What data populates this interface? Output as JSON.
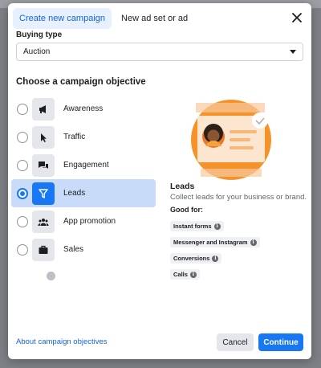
{
  "tabs": [
    {
      "label": "Create new campaign",
      "active": true
    },
    {
      "label": "New ad set or ad",
      "active": false
    }
  ],
  "buying_type": {
    "label": "Buying type",
    "value": "Auction"
  },
  "objectives_section": {
    "title": "Choose a campaign objective",
    "items": [
      {
        "label": "Awareness",
        "icon": "megaphone-icon",
        "selected": false
      },
      {
        "label": "Traffic",
        "icon": "cursor-icon",
        "selected": false
      },
      {
        "label": "Engagement",
        "icon": "chat-bubbles-icon",
        "selected": false
      },
      {
        "label": "Leads",
        "icon": "funnel-icon",
        "selected": true
      },
      {
        "label": "App promotion",
        "icon": "people-icon",
        "selected": false
      },
      {
        "label": "Sales",
        "icon": "briefcase-icon",
        "selected": false
      }
    ]
  },
  "detail": {
    "title": "Leads",
    "description": "Collect leads for your business or brand.",
    "good_for_label": "Good for:",
    "chips": [
      "Instant forms",
      "Messenger and Instagram",
      "Conversions",
      "Calls"
    ]
  },
  "footer": {
    "link": "About campaign objectives",
    "cancel": "Cancel",
    "continue": "Continue"
  },
  "colors": {
    "accent": "#1877f2",
    "selected_bg": "#c8dcfa",
    "illustration_orange": "#f5922a"
  }
}
